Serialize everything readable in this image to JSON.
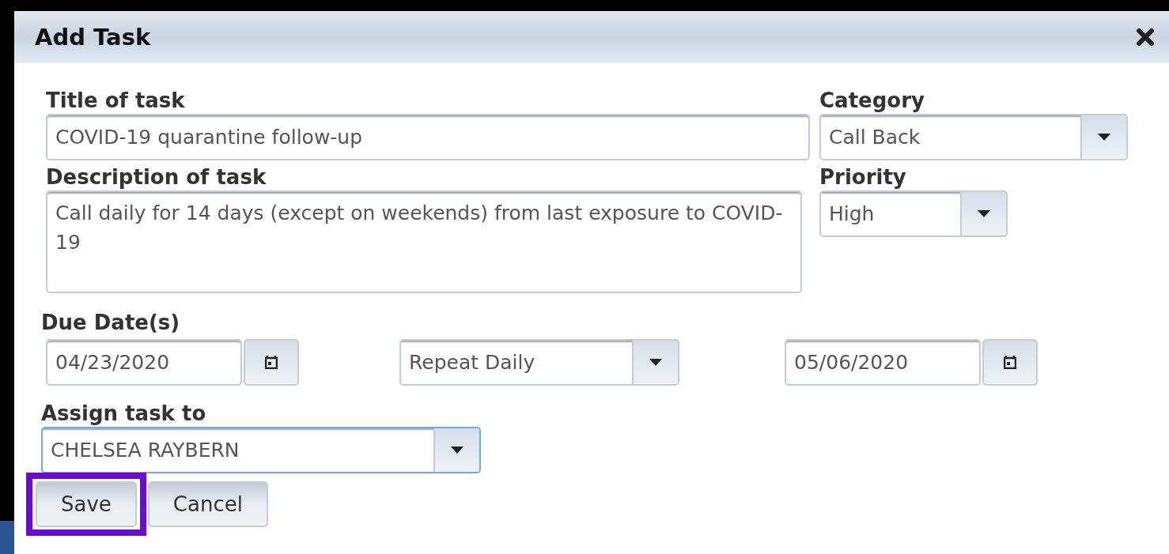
{
  "dialog": {
    "title": "Add Task"
  },
  "title_field": {
    "label": "Title of task",
    "value": "COVID-19 quarantine follow-up"
  },
  "category": {
    "label": "Category",
    "value": "Call Back"
  },
  "description": {
    "label": "Description of task",
    "value": "Call daily for 14 days (except on weekends) from last exposure to COVID-19"
  },
  "priority": {
    "label": "Priority",
    "value": "High"
  },
  "due_dates": {
    "label": "Due Date(s)",
    "start": "04/23/2020",
    "repeat": "Repeat Daily",
    "end": "05/06/2020"
  },
  "assign": {
    "label": "Assign task to",
    "value": "CHELSEA RAYBERN",
    "focused": true
  },
  "buttons": [
    {
      "label": "Save",
      "highlighted": true
    },
    {
      "label": "Cancel",
      "highlighted": false
    }
  ]
}
